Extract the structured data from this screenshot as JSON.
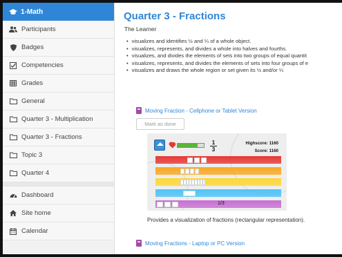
{
  "sidebar": {
    "course": {
      "label": "1-Math",
      "icon": "graduation-cap-icon"
    },
    "items": [
      {
        "label": "Participants",
        "icon": "users-icon"
      },
      {
        "label": "Badges",
        "icon": "shield-icon"
      },
      {
        "label": "Competencies",
        "icon": "checkbox-icon"
      },
      {
        "label": "Grades",
        "icon": "table-icon"
      },
      {
        "label": "General",
        "icon": "folder-icon"
      },
      {
        "label": "Quarter 3 - Multiplication",
        "icon": "folder-icon"
      },
      {
        "label": "Quarter 3 - Fractions",
        "icon": "folder-icon"
      },
      {
        "label": "Topic 3",
        "icon": "folder-icon"
      },
      {
        "label": "Quarter 4",
        "icon": "folder-icon"
      }
    ],
    "site_items": [
      {
        "label": "Dashboard",
        "icon": "dashboard-icon"
      },
      {
        "label": "Site home",
        "icon": "home-icon"
      },
      {
        "label": "Calendar",
        "icon": "calendar-icon"
      }
    ]
  },
  "main": {
    "title": "Quarter 3 - Fractions",
    "learner": "The Learner",
    "objectives": [
      "visualizes and identifies ½ and ¼  of a whole object.",
      "visualizes, represents, and divides a whole into halves and fourths.",
      "visualizes, and divides the elements of sets into two groups of equal quantit",
      "visualizes, represents, and divides the elements of sets into four groups of e",
      "visualizes and draws the whole region or set given its ½ and/or ¼"
    ],
    "activity1": {
      "link": "Moving Fraction - Cellphone or Tablet Version",
      "mark_done": "Mark as done",
      "description": "Provides a visualization of fractions (rectangular representation)."
    },
    "activity2": {
      "link": "Moving Fractions - Laptop or PC Version"
    }
  },
  "game": {
    "numerator": "1",
    "denominator": "3",
    "highscore": "Highscore: 1160",
    "score": "Score: 1160",
    "health_fraction": 0.75,
    "bottom_label": "1/3",
    "track_colors": [
      "#e53935",
      "#f9a825",
      "#fdd835",
      "#4fc3f7",
      "#c76fd3"
    ]
  }
}
